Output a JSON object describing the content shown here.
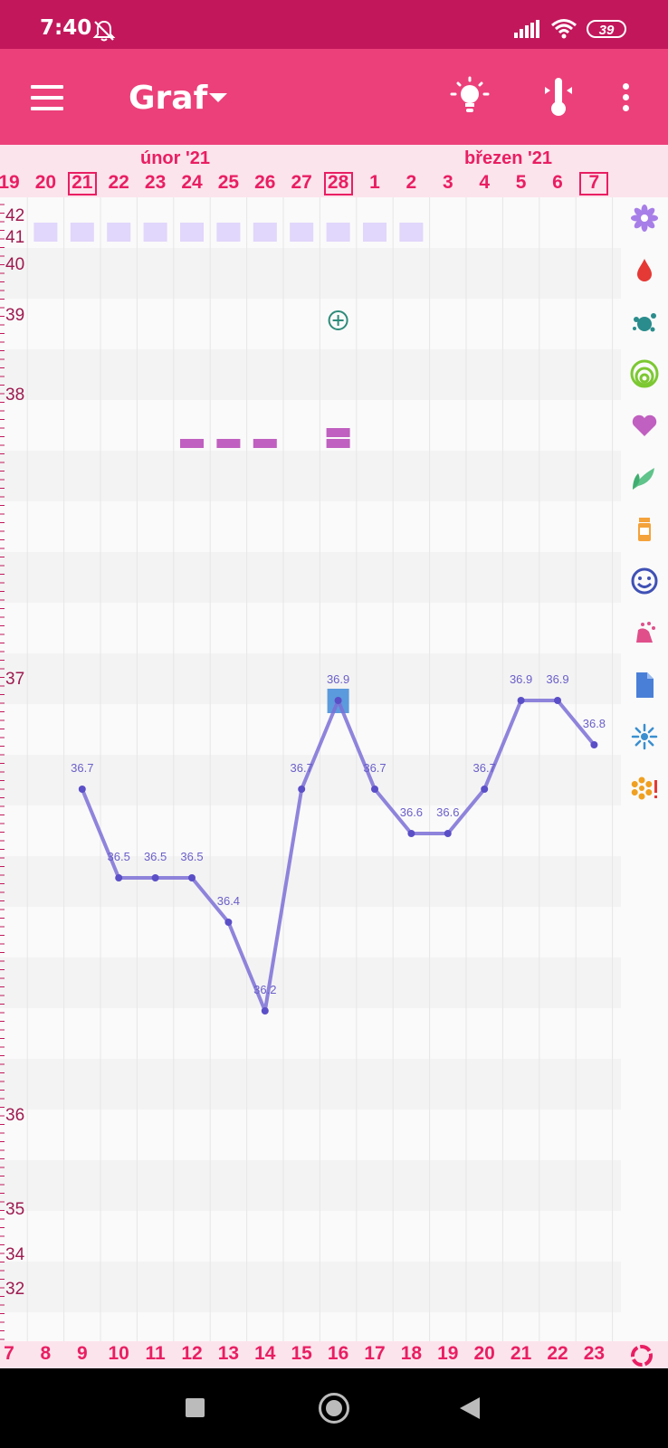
{
  "status_bar": {
    "time": "7:40",
    "battery": "39"
  },
  "app_bar": {
    "title": "Graf"
  },
  "header": {
    "months": [
      "únor '21",
      "březen '21"
    ],
    "days": [
      "19",
      "20",
      "21",
      "22",
      "23",
      "24",
      "25",
      "26",
      "27",
      "28",
      "1",
      "2",
      "3",
      "4",
      "5",
      "6",
      "7"
    ],
    "boxed_days": [
      "21",
      "28",
      "7"
    ]
  },
  "y_axis_labels": [
    "42",
    "41",
    "40",
    "39",
    "38",
    "37",
    "36",
    "35",
    "34",
    "32"
  ],
  "chart_data": {
    "type": "line",
    "x": [
      "21",
      "22",
      "23",
      "24",
      "25",
      "26",
      "27",
      "28",
      "1",
      "2",
      "3",
      "4",
      "5",
      "6",
      "7"
    ],
    "values": [
      36.7,
      36.5,
      36.5,
      36.5,
      36.4,
      36.2,
      36.7,
      36.9,
      36.7,
      36.6,
      36.6,
      36.7,
      36.9,
      36.9,
      36.8
    ],
    "point_labels": [
      "36.7",
      "36.5",
      "36.5",
      "36.5",
      "36.4",
      "36.2",
      "36.7",
      "36.9",
      "36.7",
      "36.6",
      "36.6",
      "36.7",
      "36.9",
      "36.9",
      "36.8"
    ],
    "line_color": "#7b6ed6"
  },
  "markers": {
    "period_row_days": [
      "20",
      "21",
      "22",
      "23",
      "24",
      "25",
      "26",
      "27",
      "28",
      "1",
      "2"
    ],
    "pink_bars_days": [
      "24",
      "25",
      "26",
      "28"
    ],
    "circle_plus_day": "28",
    "highlight_day": "28",
    "colors": {
      "period": "#e1d6fb",
      "pink": "#c060c0",
      "accent": "#e91e63",
      "highlight": "#4a90d9"
    }
  },
  "bottom_days": [
    "7",
    "8",
    "9",
    "10",
    "11",
    "12",
    "13",
    "14",
    "15",
    "16",
    "17",
    "18",
    "19",
    "20",
    "21",
    "22",
    "23"
  ],
  "sidebar_icons": [
    "flower-icon",
    "blood-drop-icon",
    "splash-icon",
    "cervix-rings-icon",
    "heart-icon",
    "leaf-icon",
    "pill-bottle-icon",
    "smiley-icon",
    "hand-icon",
    "document-icon",
    "sparkle-icon",
    "flower-alert-icon"
  ]
}
